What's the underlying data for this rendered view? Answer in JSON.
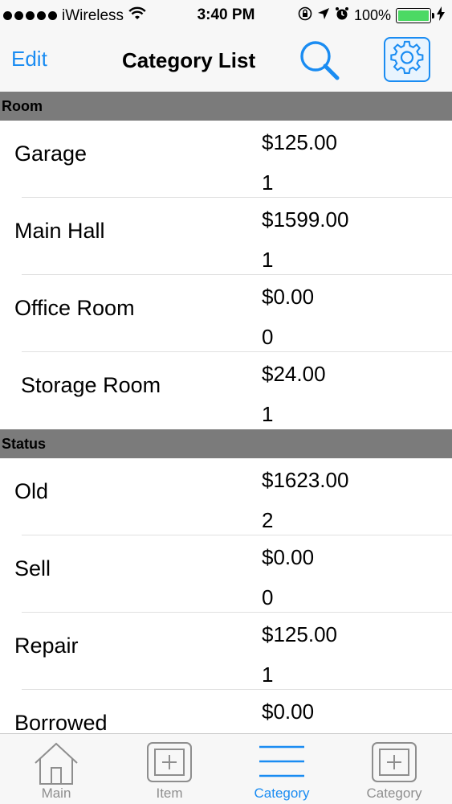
{
  "status_bar": {
    "carrier": "iWireless",
    "time": "3:40 PM",
    "battery_percent": "100%",
    "signal_dots": 5
  },
  "nav": {
    "edit_label": "Edit",
    "title": "Category List",
    "search_icon": "search-icon",
    "settings_icon": "gear-icon"
  },
  "sections": [
    {
      "header": "Room",
      "rows": [
        {
          "name": "Garage",
          "price": "$125.00",
          "count": "1"
        },
        {
          "name": "Main Hall",
          "price": "$1599.00",
          "count": "1"
        },
        {
          "name": "Office Room",
          "price": "$0.00",
          "count": "0"
        },
        {
          "name": "Storage Room",
          "price": "$24.00",
          "count": "1"
        }
      ]
    },
    {
      "header": "Status",
      "rows": [
        {
          "name": "Old",
          "price": "$1623.00",
          "count": "2"
        },
        {
          "name": "Sell",
          "price": "$0.00",
          "count": "0"
        },
        {
          "name": "Repair",
          "price": "$125.00",
          "count": "1"
        },
        {
          "name": "Borrowed",
          "price": "$0.00",
          "count": ""
        }
      ]
    }
  ],
  "tabs": [
    {
      "label": "Main",
      "icon": "home-icon",
      "active": false
    },
    {
      "label": "Item",
      "icon": "framed-plus-icon",
      "active": false
    },
    {
      "label": "Category",
      "icon": "list-lines-icon",
      "active": true
    },
    {
      "label": "Category",
      "icon": "framed-plus-icon",
      "active": false
    }
  ],
  "colors": {
    "accent": "#1a8cf2",
    "section_header": "#7b7b7b",
    "battery": "#4cd964"
  }
}
